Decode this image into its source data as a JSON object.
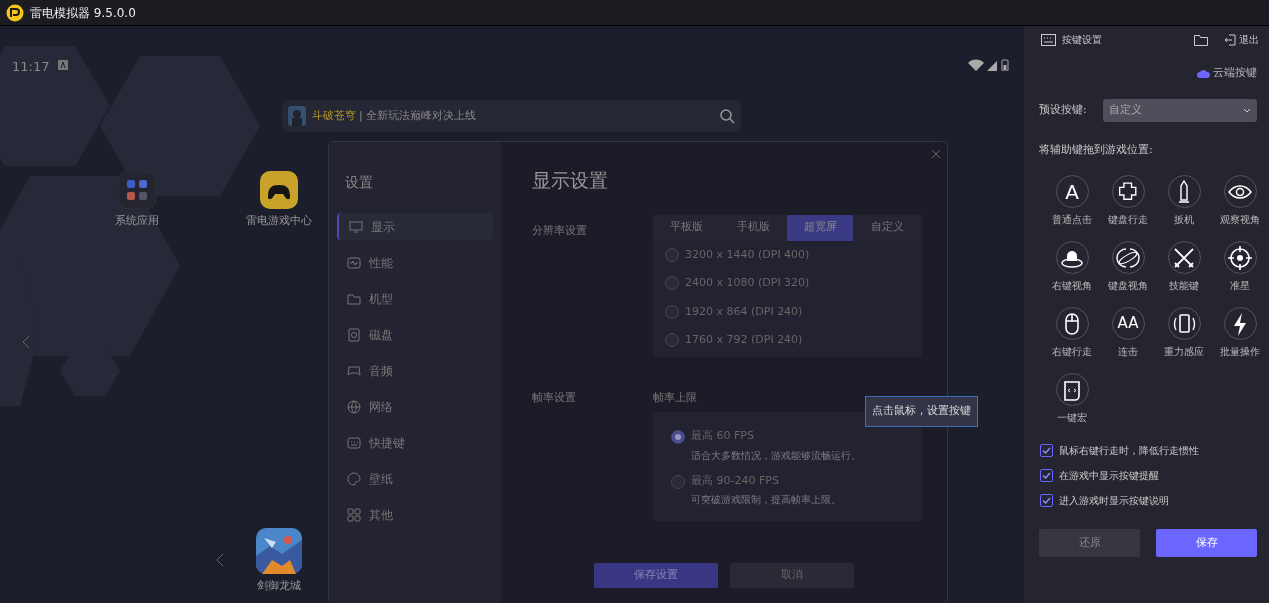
{
  "title_bar": {
    "title": "雷电模拟器 9.5.0.0"
  },
  "android": {
    "time": "11:17",
    "banner": {
      "game": "斗破苍穹",
      "text": "| 全新玩法巅峰对决上线"
    },
    "apps": [
      {
        "label": "系统应用"
      },
      {
        "label": "雷电游戏中心"
      },
      {
        "label": "剑御龙城"
      }
    ]
  },
  "settings_dialog": {
    "sidebar_title": "设置",
    "nav": [
      {
        "label": "显示",
        "selected": true
      },
      {
        "label": "性能",
        "selected": false
      },
      {
        "label": "机型",
        "selected": false
      },
      {
        "label": "磁盘",
        "selected": false
      },
      {
        "label": "音频",
        "selected": false
      },
      {
        "label": "网络",
        "selected": false
      },
      {
        "label": "快捷键",
        "selected": false
      },
      {
        "label": "壁纸",
        "selected": false
      },
      {
        "label": "其他",
        "selected": false
      }
    ],
    "heading": "显示设置",
    "resolution": {
      "label": "分辨率设置",
      "tabs": [
        {
          "label": "平板版",
          "selected": false
        },
        {
          "label": "手机版",
          "selected": false
        },
        {
          "label": "超宽屏",
          "selected": true
        },
        {
          "label": "自定义",
          "selected": false
        }
      ],
      "options": [
        {
          "label": "3200 x 1440  (DPI 400)",
          "selected": false
        },
        {
          "label": "2400 x 1080  (DPI 320)",
          "selected": false
        },
        {
          "label": "1920 x 864  (DPI 240)",
          "selected": false
        },
        {
          "label": "1760 x 792  (DPI 240)",
          "selected": false
        }
      ]
    },
    "frame_rate": {
      "label": "帧率设置",
      "sublabel": "帧率上限",
      "options": [
        {
          "label": "最高 60 FPS",
          "hint": "适合大多数情况，游戏能够流畅运行。",
          "selected": true
        },
        {
          "label": "最高 90-240 FPS",
          "hint": "可突破游戏限制，提高帧率上限。",
          "selected": false
        }
      ]
    },
    "buttons": [
      {
        "label": "保存设置",
        "kind": "primary"
      },
      {
        "label": "取消",
        "kind": "secondary"
      }
    ]
  },
  "tooltip": "点击鼠标，设置按键",
  "key_panel": {
    "title": "按键设置",
    "exit": "退出",
    "cloud": "云端按键",
    "preset_label": "预设按键:",
    "preset_value": "自定义",
    "drag_hint": "将辅助键拖到游戏位置:",
    "tools": [
      {
        "label": "普通点击",
        "glyph": "A"
      },
      {
        "label": "键盘行走"
      },
      {
        "label": "扳机"
      },
      {
        "label": "观察视角"
      },
      {
        "label": "右键视角"
      },
      {
        "label": "键盘视角"
      },
      {
        "label": "技能键"
      },
      {
        "label": "准星"
      },
      {
        "label": "右键行走"
      },
      {
        "label": "连击",
        "glyph": "AA"
      },
      {
        "label": "重力感应"
      },
      {
        "label": "批量操作"
      },
      {
        "label": "一键宏"
      }
    ],
    "options": [
      {
        "label": "鼠标右键行走时，降低行走惯性",
        "checked": true
      },
      {
        "label": "在游戏中显示按键提醒",
        "checked": true
      },
      {
        "label": "进入游戏时显示按键说明",
        "checked": true
      }
    ],
    "buttons": [
      {
        "label": "还原",
        "kind": "secondary"
      },
      {
        "label": "保存",
        "kind": "primary"
      }
    ]
  }
}
